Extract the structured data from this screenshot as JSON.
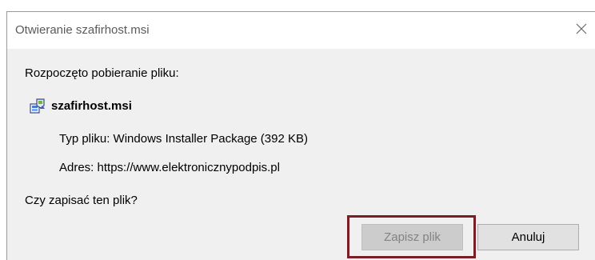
{
  "dialog": {
    "title": "Otwieranie szafirhost.msi",
    "close_icon": "close-icon",
    "intro": "Rozpoczęto pobieranie pliku:",
    "file": {
      "icon": "msi-installer-icon",
      "name": "szafirhost.msi"
    },
    "type_label": "Typ pliku:",
    "type_value": "Windows Installer Package (392 KB)",
    "address_label": "Adres:",
    "address_value": "https://www.elektronicznypodpis.pl",
    "question": "Czy zapisać ten plik?",
    "buttons": {
      "save": "Zapisz plik",
      "save_disabled": true,
      "cancel": "Anuluj"
    }
  },
  "colors": {
    "highlight_border": "#7a1e25",
    "dialog_background": "#f0f0f0",
    "title_text": "#5a5a5a",
    "disabled_text": "#838383"
  }
}
